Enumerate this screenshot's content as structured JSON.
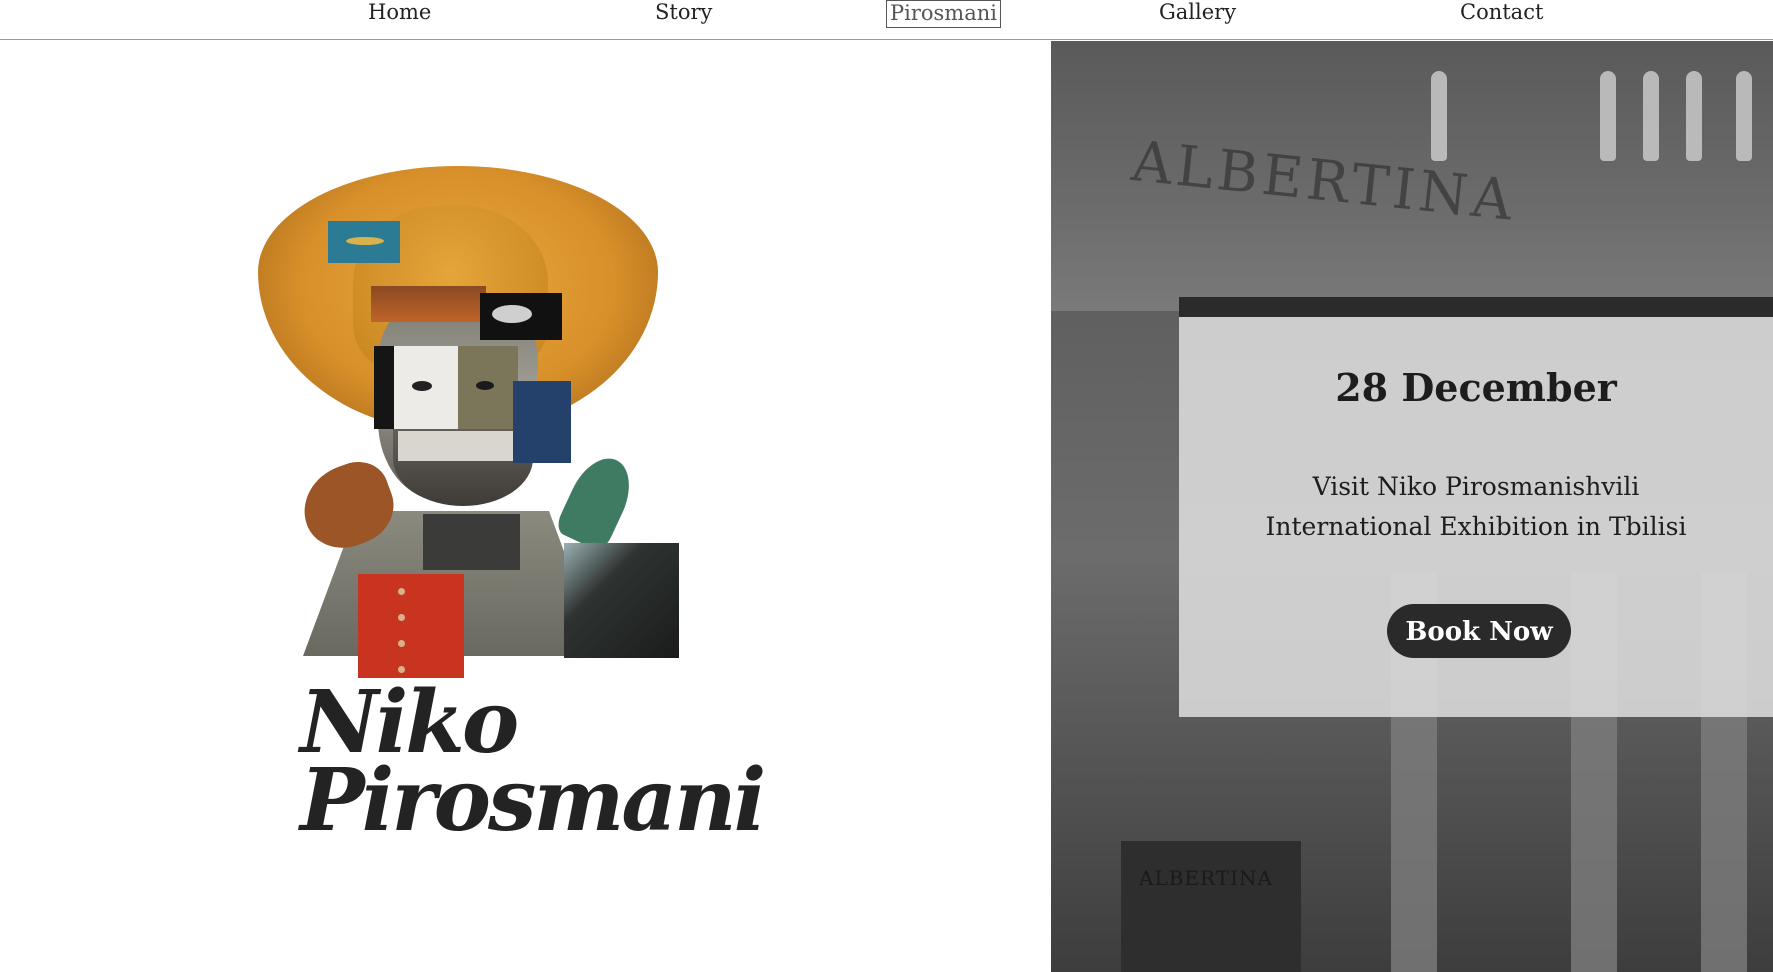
{
  "nav": {
    "items": [
      {
        "label": "Home"
      },
      {
        "label": "Story"
      },
      {
        "label": "Pirosmani"
      },
      {
        "label": "Gallery"
      },
      {
        "label": "Contact"
      }
    ],
    "active": "Pirosmani"
  },
  "hero": {
    "title_line1": "Niko",
    "title_line2": "Pirosmani"
  },
  "background": {
    "building_sign": "ALBERTINA",
    "entrance_sign": "ALBERTINA"
  },
  "event": {
    "date": "28 December",
    "description_line1": "Visit Niko Pirosmanishvili",
    "description_line2": "International Exhibition in Tbilisi",
    "cta_label": "Book Now"
  },
  "colors": {
    "text": "#222222",
    "button_bg": "#2a2a2a",
    "button_text": "#ffffff",
    "hat": "#e0a035"
  }
}
